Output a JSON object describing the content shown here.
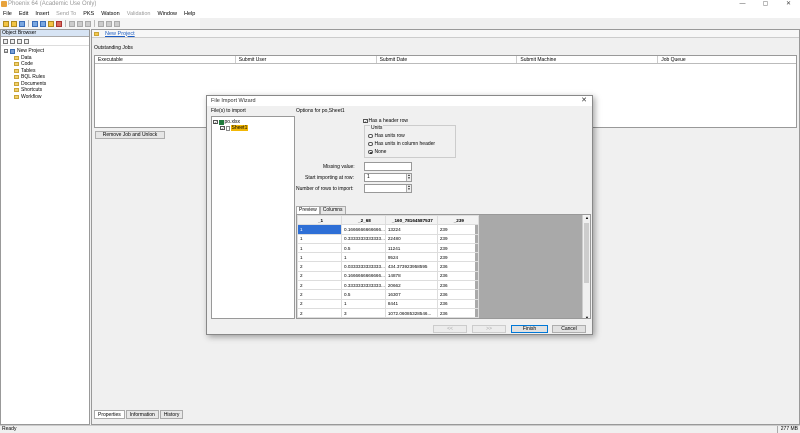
{
  "app": {
    "title": "Phoenix 64 (Academic Use Only)",
    "window_buttons": [
      "—",
      "▢",
      "✕"
    ]
  },
  "menu": [
    "File",
    "Edit",
    "Insert",
    "Send To",
    "PKS",
    "Watson",
    "Validation",
    "Window",
    "Help"
  ],
  "object_browser": {
    "title": "Object Browser",
    "tree_root": "New Project",
    "items": [
      "Data",
      "Code",
      "Tables",
      "BQL Rules",
      "Documents",
      "Shortcuts",
      "Workflow"
    ]
  },
  "main": {
    "tab_link": "New Project",
    "section_label": "Outstanding Jobs",
    "columns": [
      "Executable",
      "Submit User",
      "Submit Date",
      "Submit Machine",
      "Job Queue"
    ],
    "remove_button": "Remove Job and Unlock",
    "bottom_tabs": [
      "Properties",
      "Information",
      "History"
    ]
  },
  "status": {
    "left": "Ready",
    "memory": "277 MB"
  },
  "dialog": {
    "title": "File Import Wizard",
    "close": "✕",
    "files_label": "File(s) to import",
    "file_name": "po.xlsx",
    "sheet_name": "Sheet1",
    "options_label": "Options for po,Sheet1",
    "header_row_label": "Has a header row",
    "units_title": "Units",
    "unit_options": [
      "Has units row",
      "Has units in column header",
      "None"
    ],
    "missing_label": "Missing value:",
    "missing_value": "",
    "start_label": "Start importing at row:",
    "start_value": "1",
    "rows_label": "Number of rows to import:",
    "rows_value": "",
    "preview_tabs": [
      "Preview",
      "Columns"
    ],
    "preview_headers": [
      "_1",
      "_2_68",
      "_160_78164587537",
      "_239"
    ],
    "preview_rows": [
      [
        "1",
        "0.1666666666666...",
        "13224",
        "239"
      ],
      [
        "1",
        "0.3333333333333...",
        "22480",
        "239"
      ],
      [
        "1",
        "0.5",
        "11241",
        "239"
      ],
      [
        "1",
        "1",
        "9524",
        "239"
      ],
      [
        "2",
        "0.0333333333333...",
        "434.373923958595",
        "236"
      ],
      [
        "2",
        "0.1666666666666...",
        "14878",
        "236"
      ],
      [
        "2",
        "0.3333333333333...",
        "20662",
        "236"
      ],
      [
        "2",
        "0.5",
        "16307",
        "236"
      ],
      [
        "2",
        "1",
        "8441",
        "236"
      ],
      [
        "2",
        "3",
        "1072.06085328546...",
        "236"
      ]
    ],
    "buttons": {
      "back": "<<",
      "next": ">>",
      "finish": "Finish",
      "cancel": "Cancel"
    }
  }
}
